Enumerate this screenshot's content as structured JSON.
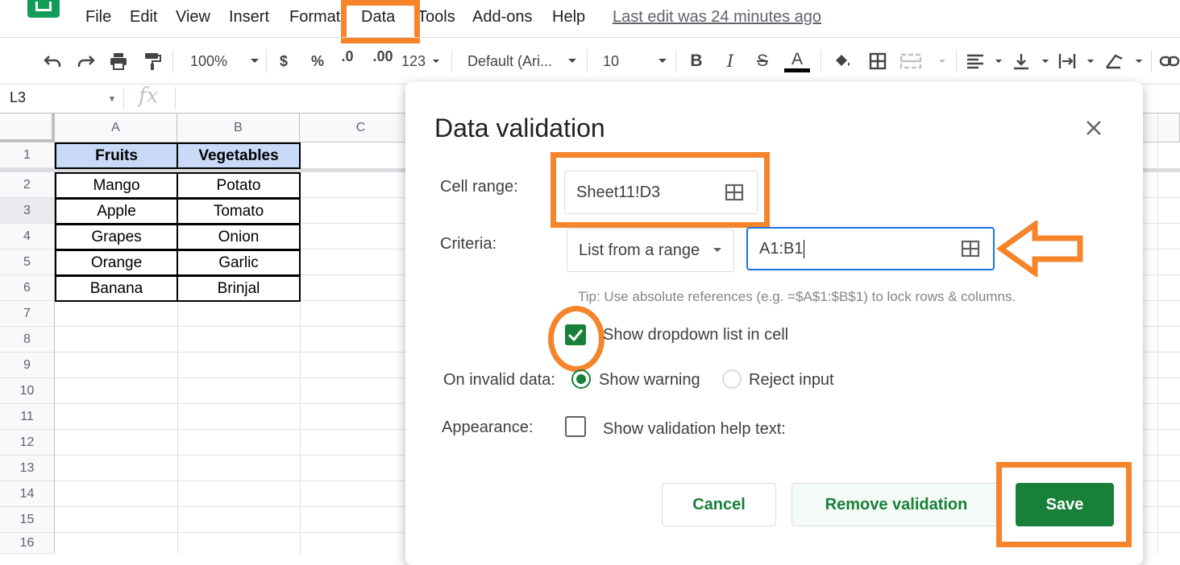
{
  "menu": {
    "items": [
      "File",
      "Edit",
      "View",
      "Insert",
      "Format",
      "Data",
      "Tools",
      "Add-ons",
      "Help"
    ],
    "last_edit": "Last edit was 24 minutes ago"
  },
  "toolbar": {
    "zoom": "100%",
    "currency": "$",
    "percent": "%",
    "dec_decrease": ".0",
    "dec_increase": ".00",
    "more_formats": "123",
    "font": "Default (Ari...",
    "font_size": "10",
    "bold": "B",
    "italic": "I",
    "strike": "S",
    "text_color": "A"
  },
  "formula_bar": {
    "cell_ref": "L3",
    "fx": "fx",
    "value": ""
  },
  "grid": {
    "columns": [
      "A",
      "B",
      "C"
    ],
    "rows": [
      "1",
      "2",
      "3",
      "4",
      "5",
      "6",
      "7",
      "8",
      "9",
      "10",
      "11",
      "12",
      "13",
      "14",
      "15",
      "16"
    ],
    "header": [
      "Fruits",
      "Vegetables"
    ],
    "data": [
      [
        "Mango",
        "Potato"
      ],
      [
        "Apple",
        "Tomato"
      ],
      [
        "Grapes",
        "Onion"
      ],
      [
        "Orange",
        "Garlic"
      ],
      [
        "Banana",
        "Brinjal"
      ]
    ]
  },
  "dialog": {
    "title": "Data validation",
    "cell_range_label": "Cell range:",
    "cell_range_value": "Sheet11!D3",
    "criteria_label": "Criteria:",
    "criteria_type": "List from a range",
    "criteria_value": "A1:B1",
    "tip": "Tip: Use absolute references (e.g. =$A$1:$B$1) to lock rows & columns.",
    "show_dropdown_label": "Show dropdown list in cell",
    "show_dropdown_checked": true,
    "invalid_label": "On invalid data:",
    "show_warning_label": "Show warning",
    "reject_input_label": "Reject input",
    "invalid_selected": "Show warning",
    "appearance_label": "Appearance:",
    "help_text_label": "Show validation help text:",
    "help_text_checked": false,
    "cancel": "Cancel",
    "remove": "Remove validation",
    "save": "Save"
  },
  "colors": {
    "accent_green": "#188038",
    "annotation_orange": "#f5842a",
    "header_fill": "#c9daf8",
    "focus_blue": "#1a73e8"
  }
}
